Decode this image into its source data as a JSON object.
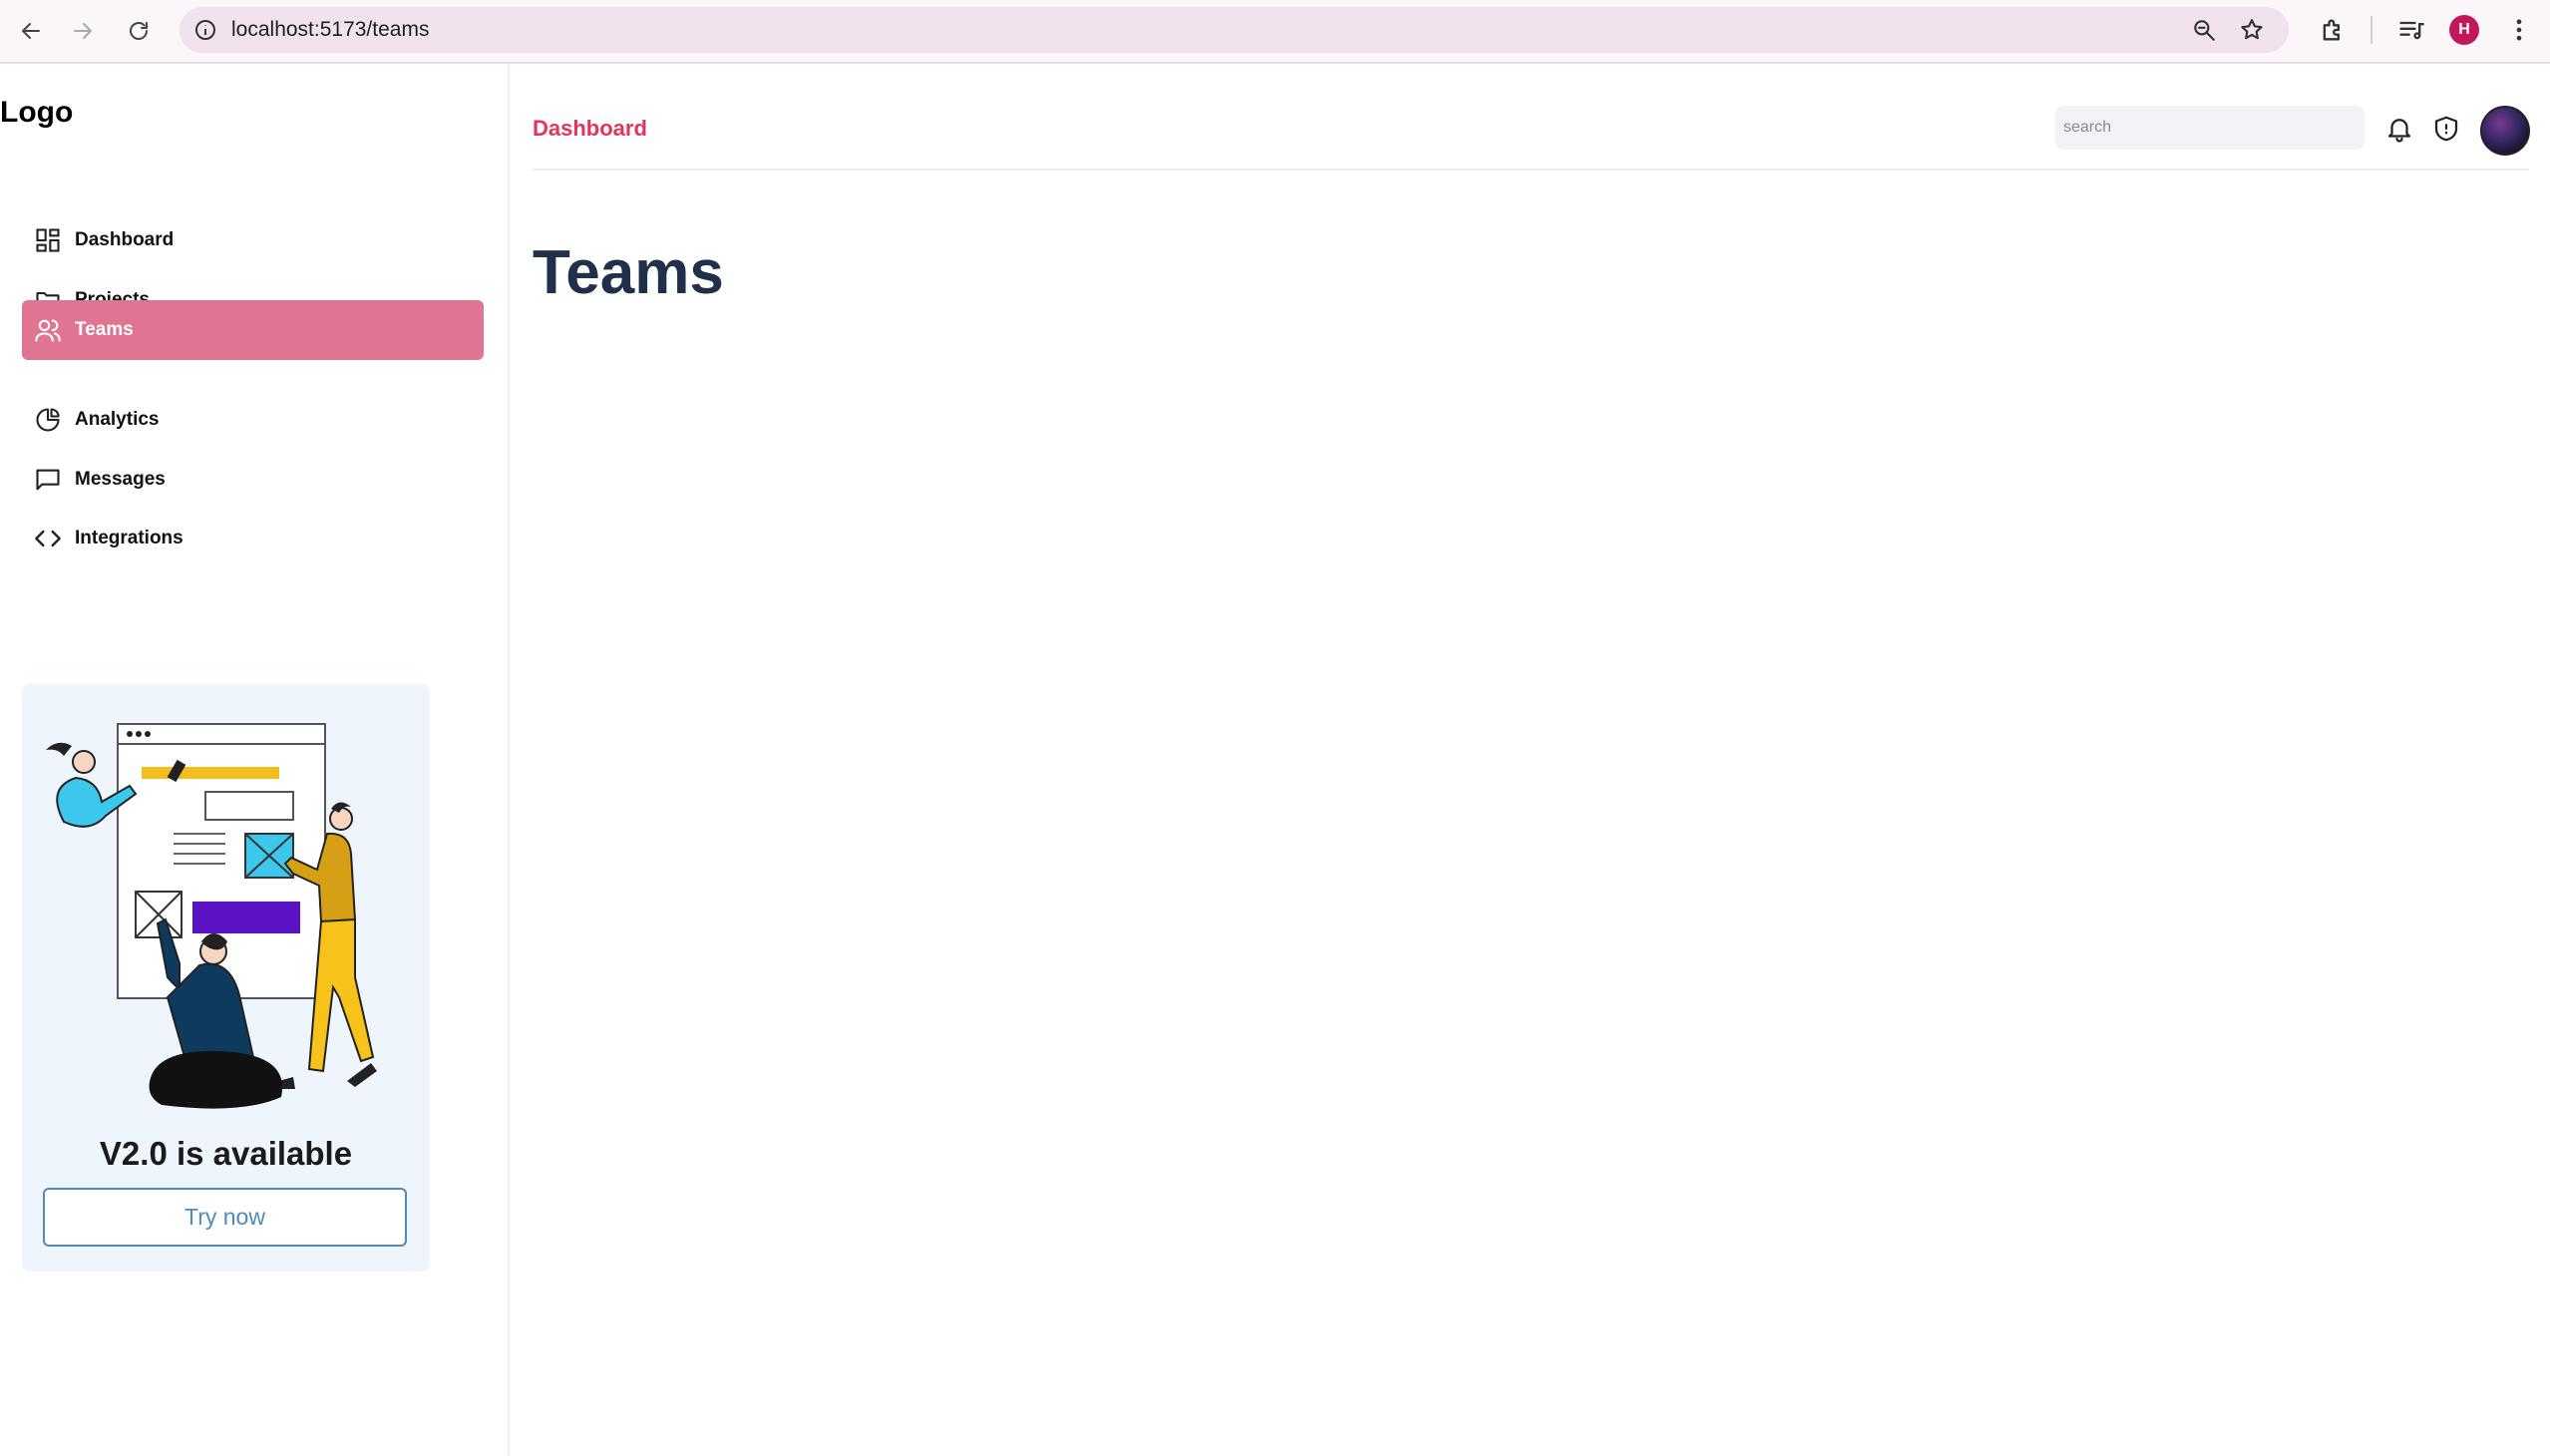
{
  "browser": {
    "url": "localhost:5173/teams",
    "profile_initial": "H"
  },
  "sidebar": {
    "logo": "Logo",
    "items": [
      {
        "label": "Dashboard",
        "icon": "dashboard-grid-icon",
        "active": false
      },
      {
        "label": "Projects",
        "icon": "folder-icon",
        "active": false
      },
      {
        "label": "Teams",
        "icon": "users-icon",
        "active": true
      },
      {
        "label": "Analytics",
        "icon": "pie-chart-icon",
        "active": false
      },
      {
        "label": "Messages",
        "icon": "message-icon",
        "active": false
      },
      {
        "label": "Integrations",
        "icon": "code-icon",
        "active": false
      }
    ],
    "promo": {
      "title": "V2.0 is available",
      "button": "Try now"
    }
  },
  "header": {
    "breadcrumb": "Dashboard",
    "search_placeholder": "search"
  },
  "main": {
    "title": "Teams"
  },
  "colors": {
    "accent": "#e0365b",
    "active_nav": "#df7493",
    "title": "#20304a"
  }
}
